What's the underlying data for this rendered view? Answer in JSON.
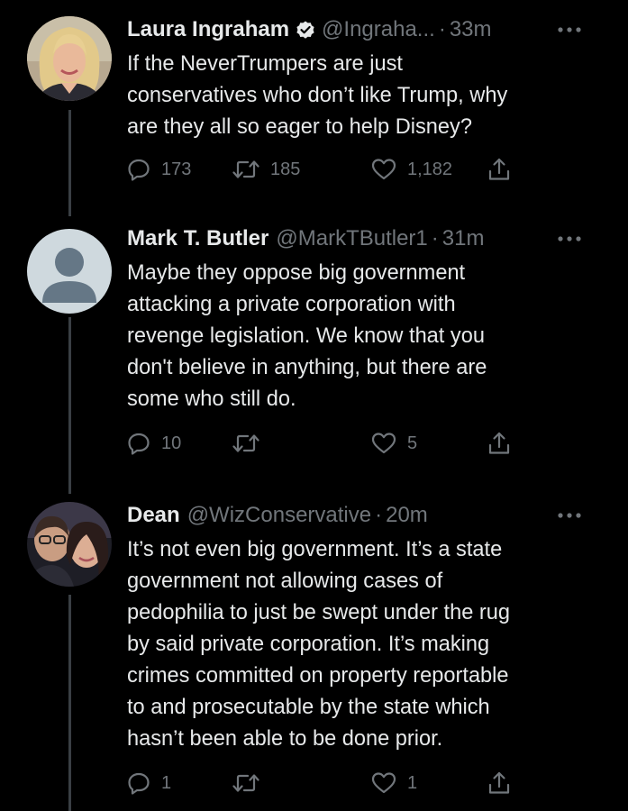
{
  "colors": {
    "background": "#000000",
    "text": "#e7e9ea",
    "secondary_text": "#71767b",
    "verified": "#e7e9ea",
    "thread_line": "#3a3f44"
  },
  "tweets": [
    {
      "name": "Laura Ingraham",
      "verified": true,
      "handle": "@Ingraha...",
      "separator": "·",
      "time": "33m",
      "text": "If the NeverTrumpers are just\nconservatives who don’t like Trump, why\nare they all so eager to help Disney?",
      "replies": "173",
      "retweets": "185",
      "likes": "1,182",
      "avatar_icon": "profile-photo"
    },
    {
      "name": "Mark T. Butler",
      "verified": false,
      "handle": "@MarkTButler1",
      "separator": "·",
      "time": "31m",
      "text": "Maybe they oppose big government\nattacking a private corporation with\nrevenge legislation.  We know that you\ndon't believe in anything, but there are\nsome who still do.",
      "replies": "10",
      "retweets": "",
      "likes": "5",
      "avatar_icon": "default-avatar-icon"
    },
    {
      "name": "Dean",
      "verified": false,
      "handle": "@WizConservative",
      "separator": "·",
      "time": "20m",
      "text": "It’s not even big government. It’s a state\ngovernment not allowing cases of\npedophilia to just be swept under the rug\nby said private corporation. It’s making\ncrimes committed on property reportable\nto and prosecutable by the state which\nhasn’t been able to be done prior.",
      "replies": "1",
      "retweets": "",
      "likes": "1",
      "avatar_icon": "profile-photo"
    }
  ]
}
